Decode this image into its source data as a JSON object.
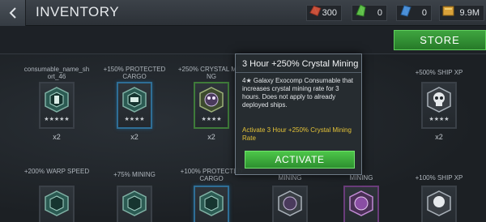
{
  "header": {
    "title": "INVENTORY",
    "resources": [
      {
        "icon": "crystal-red-icon",
        "color": "#c8503a",
        "value": "300"
      },
      {
        "icon": "crystal-green-icon",
        "color": "#5fbf4a",
        "value": "0"
      },
      {
        "icon": "crystal-blue-icon",
        "color": "#4a8fd8",
        "value": "0"
      },
      {
        "icon": "latinum-icon",
        "color": "#d9a23a",
        "value": "9.9M"
      }
    ]
  },
  "store_label": "STORE",
  "items_row1": [
    {
      "label": "consumable_name_short_46",
      "stars": "★★★★★",
      "qty": "x2",
      "icon": "cargo-badge-icon"
    },
    {
      "label": "+150% PROTECTED CARGO",
      "stars": "★★★★",
      "qty": "x2",
      "icon": "cargo-badge-icon"
    },
    {
      "label": "+250% CRYSTAL MINING",
      "stars": "★★★★",
      "qty": "x2",
      "icon": "mining-badge-icon"
    },
    {
      "label": "+500% SHIP XP",
      "stars": "★★★★",
      "qty": "x2",
      "icon": "skull-badge-icon"
    }
  ],
  "items_row2": [
    {
      "label": "+200% WARP SPEED",
      "icon": "warp-badge-icon"
    },
    {
      "label": "+75% MINING",
      "icon": "mining-badge-icon"
    },
    {
      "label": "+100% PROTECTED CARGO",
      "icon": "cargo-badge-icon"
    },
    {
      "label": "MINING",
      "icon": "mining-badge-icon"
    },
    {
      "label": "MINING",
      "icon": "mining-badge-icon"
    },
    {
      "label": "+100% SHIP XP",
      "icon": "skull-badge-icon"
    }
  ],
  "tooltip": {
    "title": "3 Hour +250% Crystal Mining",
    "description": "4★ Galaxy Exocomp Consumable that increases crystal mining rate for 3 hours. Does not apply to already deployed ships.",
    "action_text": "Activate 3 Hour +250% Crystal Mining Rate",
    "button_label": "ACTIVATE"
  },
  "colors": {
    "accent_green": "#3fa540",
    "tooltip_highlight": "#e3c238",
    "tile_border_blue": "#2f6e96"
  }
}
